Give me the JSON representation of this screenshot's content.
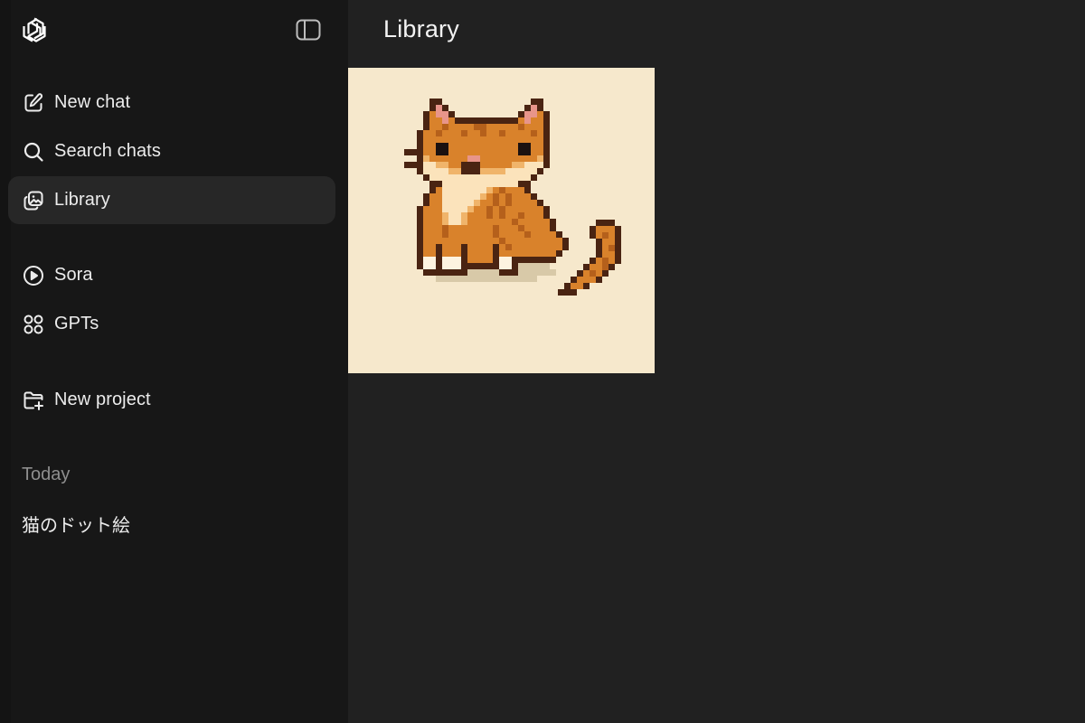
{
  "sidebar": {
    "items": [
      {
        "label": "New chat",
        "icon": "new-chat-icon"
      },
      {
        "label": "Search chats",
        "icon": "search-icon"
      },
      {
        "label": "Library",
        "icon": "library-icon",
        "active": true
      },
      {
        "label": "Sora",
        "icon": "play-circle-icon"
      },
      {
        "label": "GPTs",
        "icon": "grid-icon"
      },
      {
        "label": "New project",
        "icon": "folder-plus-icon"
      }
    ],
    "section_today": "Today",
    "chats": [
      {
        "title": "猫のドット絵"
      }
    ]
  },
  "main": {
    "title": "Library",
    "images": [
      {
        "subject": "pixel art cat",
        "icon": "pixel-cat-image"
      }
    ]
  },
  "colors": {
    "sidebar_bg": "#171717",
    "main_bg": "#212121",
    "active_item_bg": "#272727",
    "text": "#ececec",
    "muted_text": "#8e8e8e",
    "image_bg": "#f6e8cc"
  }
}
